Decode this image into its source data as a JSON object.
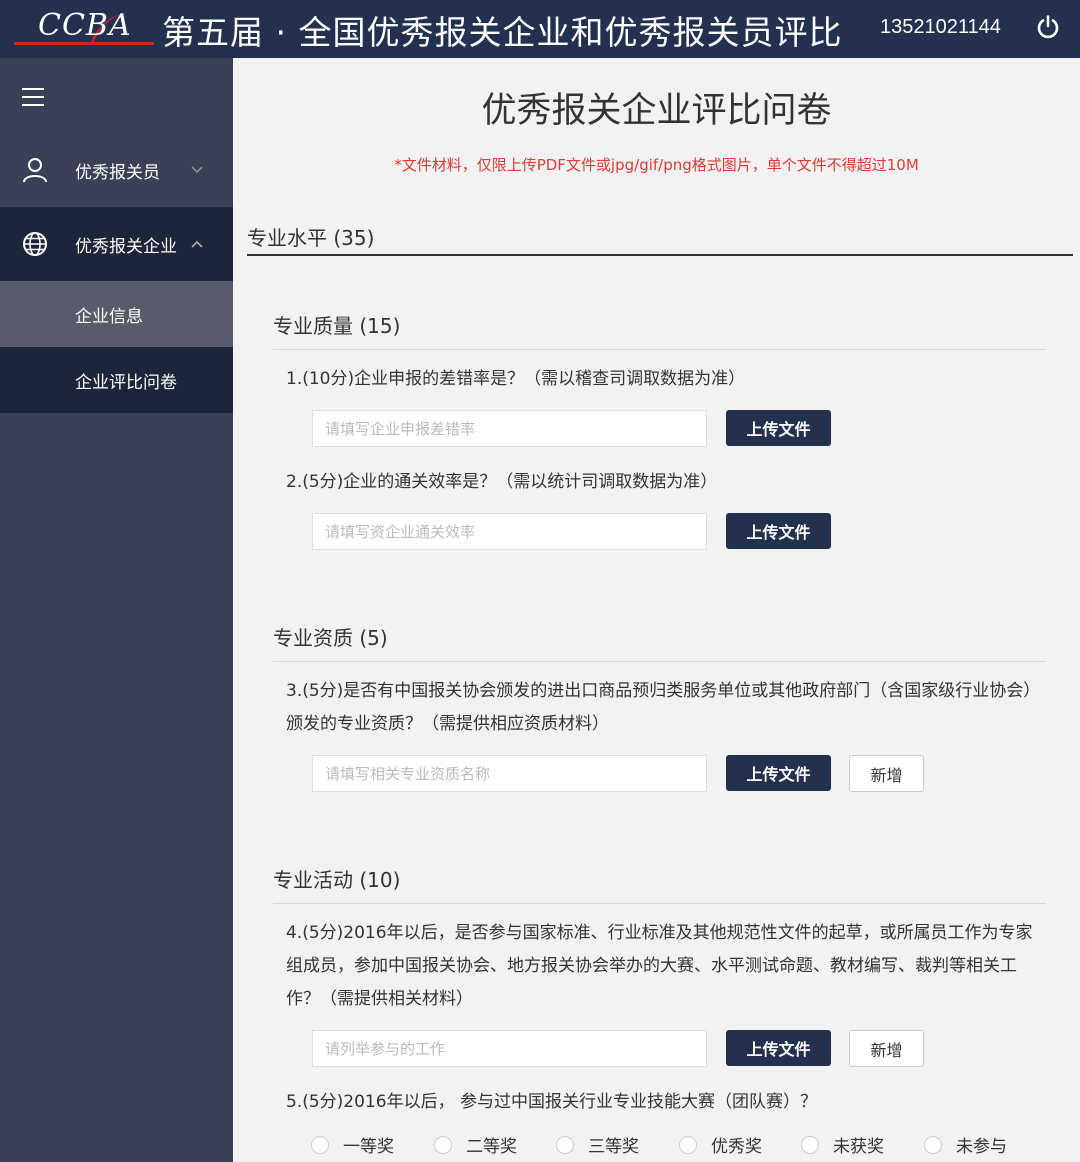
{
  "header": {
    "logo_text": "CCBA",
    "title": "第五届 · 全国优秀报关企业和优秀报关员评比",
    "phone": "13521021144"
  },
  "sidebar": {
    "items": [
      {
        "label": "优秀报关员",
        "icon": "user-icon"
      },
      {
        "label": "优秀报关企业",
        "icon": "globe-icon"
      },
      {
        "label": "企业信息"
      },
      {
        "label": "企业评比问卷"
      }
    ]
  },
  "main": {
    "title": "优秀报关企业评比问卷",
    "notice": "*文件材料，仅限上传PDF文件或jpg/gif/png格式图片，单个文件不得超过10M",
    "section_title": "专业水平 (35)",
    "groups": [
      {
        "title": "专业质量 (15)"
      },
      {
        "title": "专业资质 (5)"
      },
      {
        "title": "专业活动 (10)"
      }
    ],
    "questions": [
      {
        "text": "1.(10分)企业申报的差错率是？（需以稽查司调取数据为准）",
        "placeholder": "请填写企业申报差错率"
      },
      {
        "text": "2.(5分)企业的通关效率是？（需以统计司调取数据为准）",
        "placeholder": "请填写资企业通关效率"
      },
      {
        "text": "3.(5分)是否有中国报关协会颁发的进出口商品预归类服务单位或其他政府部门（含国家级行业协会）颁发的专业资质？（需提供相应资质材料）",
        "placeholder": "请填写相关专业资质名称"
      },
      {
        "text": "4.(5分)2016年以后，是否参与国家标准、行业标准及其他规范性文件的起草，或所属员工作为专家组成员，参加中国报关协会、地方报关协会举办的大赛、水平测试命题、教材编写、裁判等相关工作？（需提供相关材料）",
        "placeholder": "请列举参与的工作"
      },
      {
        "text": "5.(5分)2016年以后， 参与过中国报关行业专业技能大赛（团队赛）？"
      }
    ],
    "upload_label": "上传文件",
    "add_label": "新增",
    "radio_options": [
      "一等奖",
      "二等奖",
      "三等奖",
      "优秀奖",
      "未获奖",
      "未参与"
    ]
  },
  "colors": {
    "header_bg": "#24304f",
    "sidebar_bg": "#3a4055",
    "sidebar_active": "#1c2539",
    "sidebar_selected": "#585c6a",
    "accent_red": "#e53935",
    "button_bg": "#23304e"
  }
}
